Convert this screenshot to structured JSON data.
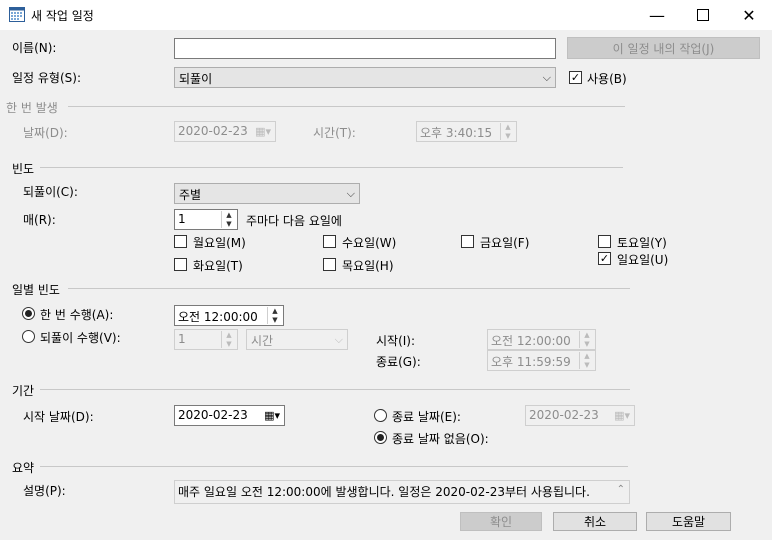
{
  "window": {
    "title": "새 작업 일정"
  },
  "name": {
    "label": "이름(N):",
    "value": "",
    "jobs_button": "이 일정 내의 작업(J)"
  },
  "schedule_type": {
    "label": "일정 유형(S):",
    "value": "되풀이",
    "enabled_label": "사용(B)",
    "enabled_checked": true
  },
  "one_time": {
    "group": "한 번 발생",
    "date_label": "날짜(D):",
    "date_value": "2020-02-23",
    "time_label": "시간(T):",
    "time_value": "오후  3:40:15"
  },
  "frequency": {
    "group": "빈도",
    "occurs_label": "되풀이(C):",
    "occurs_value": "주별",
    "every_label": "매(R):",
    "every_value": "1",
    "every_suffix": "주마다 다음 요일에",
    "days": [
      {
        "label": "월요일(M)",
        "checked": false
      },
      {
        "label": "수요일(W)",
        "checked": false
      },
      {
        "label": "금요일(F)",
        "checked": false
      },
      {
        "label": "토요일(Y)",
        "checked": false
      },
      {
        "label": "화요일(T)",
        "checked": false
      },
      {
        "label": "목요일(H)",
        "checked": false
      },
      {
        "label": "일요일(U)",
        "checked": true
      }
    ]
  },
  "daily": {
    "group": "일별 빈도",
    "once_label": "한 번 수행(A):",
    "once_value": "오전 12:00:00",
    "once_selected": true,
    "every_label": "되풀이 수행(V):",
    "every_value": "1",
    "every_unit": "시간",
    "start_label": "시작(I):",
    "start_value": "오전 12:00:00",
    "end_label": "종료(G):",
    "end_value": "오후 11:59:59"
  },
  "duration": {
    "group": "기간",
    "start_label": "시작 날짜(D):",
    "start_value": "2020-02-23",
    "end_label": "종료 날짜(E):",
    "end_value": "2020-02-23",
    "noend_label": "종료 날짜 없음(O):",
    "noend_selected": true
  },
  "summary": {
    "group": "요약",
    "desc_label": "설명(P):",
    "desc_value": "매주 일요일 오전 12:00:00에 발생합니다. 일정은 2020-02-23부터 사용됩니다."
  },
  "buttons": {
    "ok": "확인",
    "cancel": "취소",
    "help": "도움말"
  }
}
